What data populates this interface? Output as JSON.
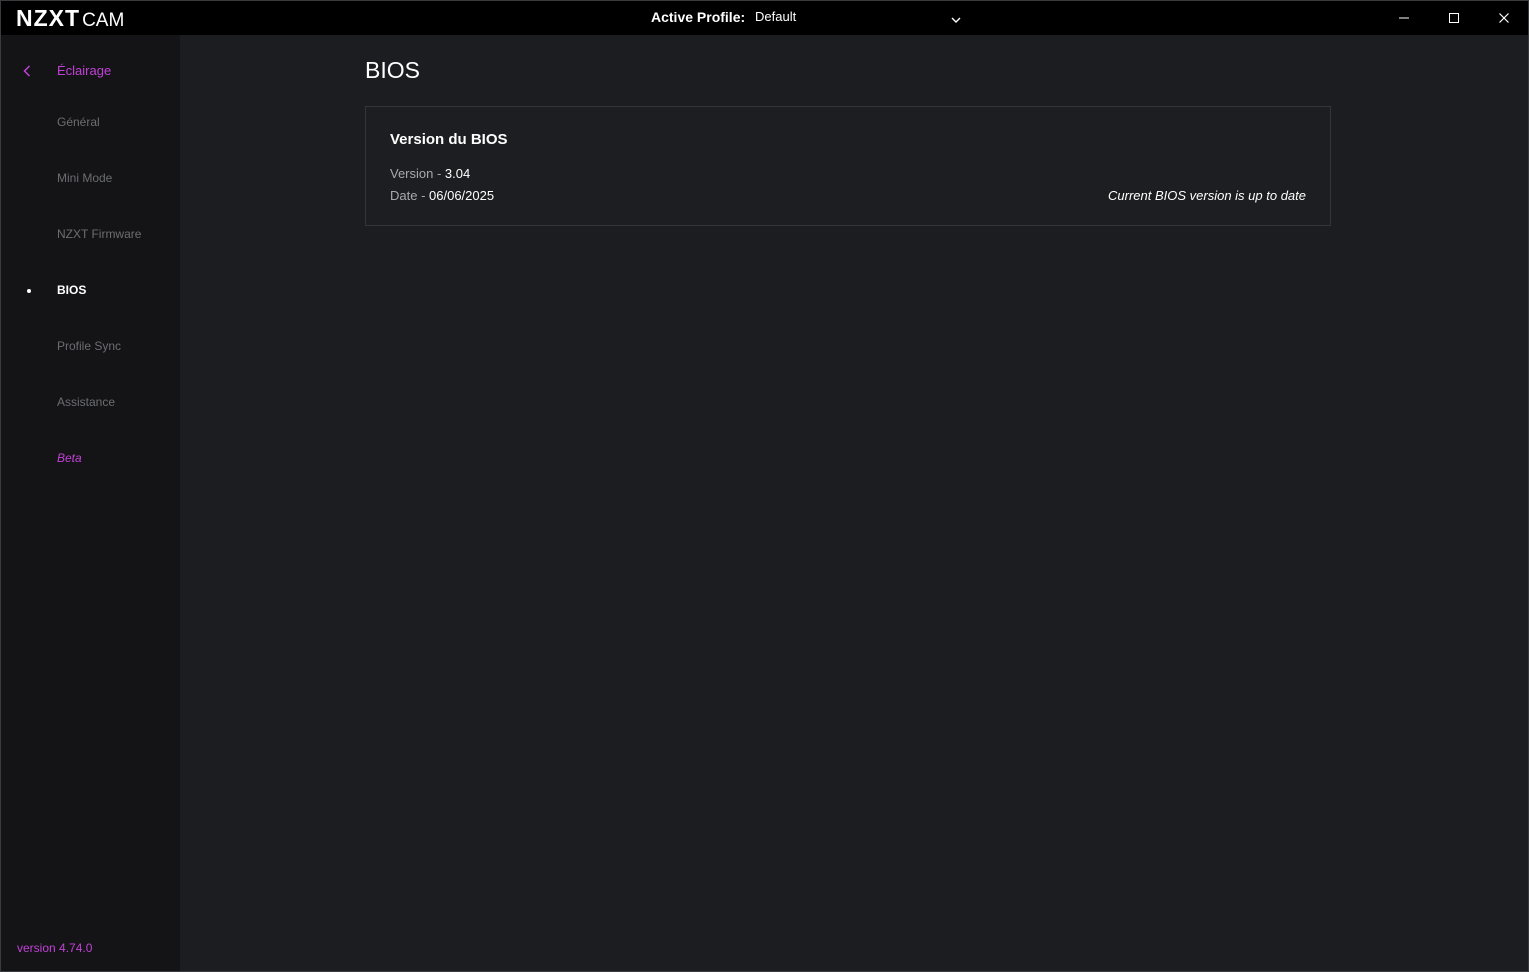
{
  "app": {
    "logo_main": "NZXT",
    "logo_sub": "CAM",
    "profile_label": "Active Profile:",
    "profile_value": "Default"
  },
  "sidebar": {
    "back_label": "Éclairage",
    "items": [
      {
        "label": "Général",
        "active": false
      },
      {
        "label": "Mini Mode",
        "active": false
      },
      {
        "label": "NZXT Firmware",
        "active": false
      },
      {
        "label": "BIOS",
        "active": true
      },
      {
        "label": "Profile Sync",
        "active": false
      },
      {
        "label": "Assistance",
        "active": false
      },
      {
        "label": "Beta",
        "active": false
      }
    ],
    "version": "version 4.74.0"
  },
  "main": {
    "title": "BIOS",
    "card": {
      "title": "Version du BIOS",
      "version_label": "Version - ",
      "version_value": "3.04",
      "date_label": "Date - ",
      "date_value": "06/06/2025",
      "status": "Current BIOS version is up to date"
    }
  },
  "colors": {
    "accent": "#c042d6",
    "background": "#1c1d20",
    "sidebar": "#141417",
    "titlebar": "#000000"
  },
  "icons": {
    "back": "chevron-left-icon",
    "dropdown": "chevron-down-icon",
    "minimize": "minimize-icon",
    "maximize": "maximize-icon",
    "close": "close-icon"
  }
}
